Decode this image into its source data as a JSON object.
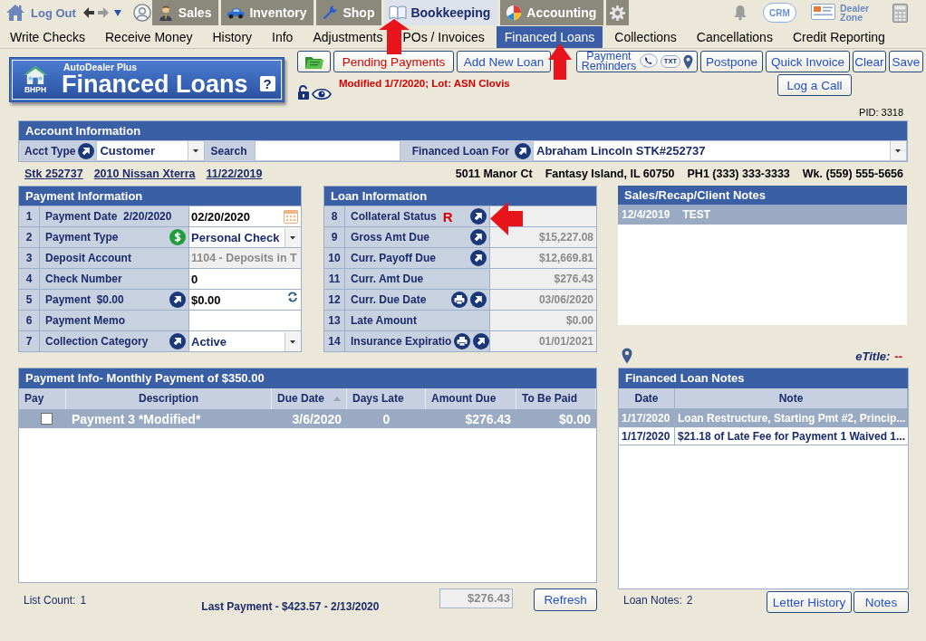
{
  "top_nav": {
    "logout": "Log Out",
    "modules": [
      {
        "label": "Sales",
        "kind": "sales",
        "selected": false,
        "callout": false
      },
      {
        "label": "Inventory",
        "kind": "inventory",
        "selected": false,
        "callout": false
      },
      {
        "label": "Shop",
        "kind": "shop",
        "selected": false,
        "callout": false
      },
      {
        "label": "Bookkeeping",
        "kind": "bookkeeping",
        "selected": true,
        "callout": true
      },
      {
        "label": "Accounting",
        "kind": "accounting",
        "selected": false,
        "callout": false
      }
    ],
    "crm": "CRM",
    "dealer_zone": "Dealer Zone"
  },
  "sub_nav": [
    {
      "label": "Write Checks",
      "selected": false,
      "callout": false
    },
    {
      "label": "Receive Money",
      "selected": false,
      "callout": false
    },
    {
      "label": "History",
      "selected": false,
      "callout": false
    },
    {
      "label": "Info",
      "selected": false,
      "callout": false
    },
    {
      "label": "Adjustments",
      "selected": false,
      "callout": false
    },
    {
      "label": "POs / Invoices",
      "selected": false,
      "callout": false
    },
    {
      "label": "Financed Loans",
      "selected": true,
      "callout": true
    },
    {
      "label": "Collections",
      "selected": false,
      "callout": false
    },
    {
      "label": "Cancellations",
      "selected": false,
      "callout": false
    },
    {
      "label": "Credit Reporting",
      "selected": false,
      "callout": false
    }
  ],
  "header": {
    "brand": "AutoDealer Plus",
    "badge": "BHPH",
    "title": "Financed Loans",
    "help": "?",
    "modified": "Modified 1/7/2020; Lot: ASN Clovis",
    "pid": "PID: 3318"
  },
  "toolbar": {
    "buttons": [
      {
        "kind": "folder"
      },
      {
        "kind": "alert",
        "label": "Pending Payments"
      },
      {
        "kind": "plain",
        "label": "Add New Loan"
      },
      {
        "kind": "reminders",
        "label": "Payment Reminders",
        "tag": "TXT"
      },
      {
        "kind": "plain",
        "label": "Postpone"
      },
      {
        "kind": "plain",
        "label": "Quick Invoice"
      },
      {
        "kind": "plain",
        "label": "Clear"
      },
      {
        "kind": "plain",
        "label": "Save"
      }
    ],
    "log_call": "Log a Call"
  },
  "account": {
    "title": "Account Information",
    "acct_type_label": "Acct Type",
    "acct_type": "Customer",
    "search_label": "Search",
    "loan_for_label": "Financed Loan For",
    "loan_for": "Abraham Lincoln STK#252737",
    "vehicle": [
      "Stk 252737",
      "2010 Nissan Xterra",
      "11/22/2019"
    ],
    "contact": [
      "5011 Manor Ct",
      "Fantasy Island, IL 60750",
      "PH1 (333) 333-3333",
      "Wk. (559) 555-5656"
    ]
  },
  "payment_info": {
    "title": "Payment Information",
    "rows": [
      {
        "num": "1",
        "label": "Payment Date  2/20/2020",
        "kind": "date",
        "value": "02/20/2020"
      },
      {
        "num": "2",
        "label": "Payment Type",
        "kind": "type",
        "value": "Personal Check"
      },
      {
        "num": "3",
        "label": "Deposit Account",
        "kind": "readonly",
        "value": "1104 - Deposits in T"
      },
      {
        "num": "4",
        "label": "Check Number",
        "kind": "text",
        "value": "0"
      },
      {
        "num": "5",
        "label": "Payment  $0.00",
        "kind": "amount",
        "value": "$0.00"
      },
      {
        "num": "6",
        "label": "Payment Memo",
        "kind": "memo"
      },
      {
        "num": "7",
        "label": "Collection Category",
        "kind": "category",
        "value": "Active"
      }
    ]
  },
  "loan_info": {
    "title": "Loan Information",
    "rows": [
      {
        "num": "8",
        "label": "Collateral Status",
        "kind": "status",
        "flag": "R",
        "callout": true
      },
      {
        "num": "9",
        "label": "Gross Amt Due",
        "kind": "link",
        "value": "$15,227.08",
        "callout": false
      },
      {
        "num": "10",
        "label": "Curr. Payoff Due",
        "kind": "link",
        "value": "$12,669.81",
        "callout": false
      },
      {
        "num": "11",
        "label": "Curr. Amt Due",
        "kind": "plain",
        "value": "$276.43",
        "callout": false
      },
      {
        "num": "12",
        "label": "Curr. Due Date",
        "kind": "print",
        "value": "03/06/2020",
        "callout": false
      },
      {
        "num": "13",
        "label": "Late Amount",
        "kind": "plain",
        "value": "$0.00",
        "callout": false
      },
      {
        "num": "14",
        "label": "Insurance Expiratio",
        "kind": "print",
        "value": "01/01/2021",
        "callout": false
      }
    ]
  },
  "client_notes": {
    "title": "Sales/Recap/Client Notes",
    "rows": [
      {
        "date": "12/4/2019",
        "text": "TEST",
        "selected": true
      }
    ]
  },
  "etitle": {
    "label": "eTitle:",
    "value": "--"
  },
  "loan_notes": {
    "title": "Financed Loan Notes",
    "columns": [
      "Date",
      "Note"
    ],
    "rows": [
      {
        "date": "1/17/2020",
        "note": "Loan Restructure, Starting Pmt #2, Princip...",
        "selected": true
      },
      {
        "date": "1/17/2020",
        "note": "$21.18 of Late Fee for Payment 1 Waived 1...",
        "selected": false
      }
    ],
    "count_label": "Loan Notes:",
    "count": "2",
    "buttons": [
      "Letter History",
      "Notes"
    ]
  },
  "schedule": {
    "title": "Payment Info- Monthly Payment of $350.00",
    "columns": [
      {
        "label": "Pay",
        "sorted": false
      },
      {
        "label": "Description",
        "sorted": false
      },
      {
        "label": "Due Date",
        "sorted": true
      },
      {
        "label": "Days Late",
        "sorted": false
      },
      {
        "label": "Amount Due",
        "sorted": false
      },
      {
        "label": "To Be Paid",
        "sorted": false
      }
    ],
    "rows": [
      {
        "checked": false,
        "selected": true,
        "description": "Payment 3 *Modified*",
        "due_date": "3/6/2020",
        "days_late": "0",
        "amount_due": "$276.43",
        "to_be_paid": "$0.00"
      }
    ],
    "count_label": "List Count:",
    "count": "1",
    "last_payment": "Last Payment - $423.57 - 2/13/2020",
    "total": "$276.43",
    "refresh": "Refresh"
  }
}
